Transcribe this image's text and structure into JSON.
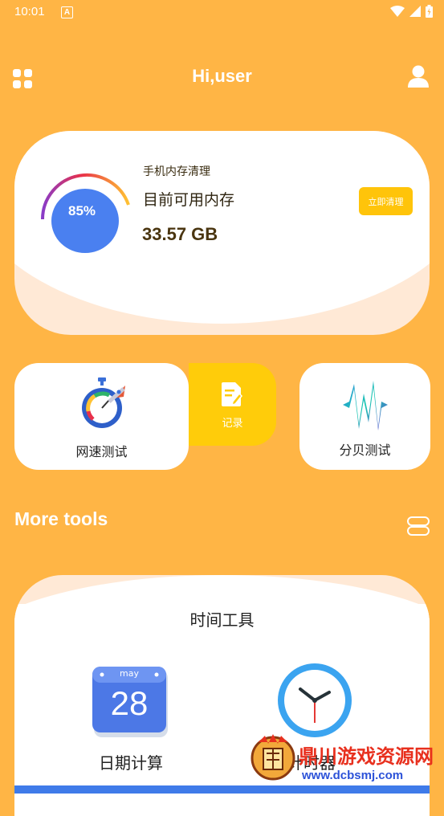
{
  "status_bar": {
    "time": "10:01",
    "notification_glyph": "A"
  },
  "header": {
    "title": "Hi,user",
    "left_icon": "grid-menu-icon",
    "right_icon": "user-icon"
  },
  "memory_card": {
    "percent_text": "85%",
    "percent_value": 85,
    "subtitle": "手机内存清理",
    "title": "目前可用内存",
    "value": "33.57 GB",
    "button_label": "立即清理",
    "colors": {
      "gauge_fill": "#4A80F0",
      "button": "#FFC40A"
    }
  },
  "tools": {
    "speed_test": {
      "label": "网速测试",
      "icon": "stopwatch-rocket-icon"
    },
    "record": {
      "label": "记录",
      "icon": "note-edit-icon"
    },
    "decibel": {
      "label": "分贝测试",
      "icon": "sound-wave-icon"
    }
  },
  "more_tools": {
    "title": "More tools",
    "toggle_icon": "list-toggle-icon",
    "time_card": {
      "title": "时间工具",
      "date_calc": {
        "label": "日期计算",
        "calendar_month": "may",
        "calendar_day": "28"
      },
      "timer": {
        "label": "计时器"
      }
    }
  },
  "watermark": {
    "line1": "鼎川游戏资源网",
    "line2": "www.dcbsmj.com"
  },
  "theme": {
    "background": "#FFB545",
    "accent_blue": "#3F7BE9"
  }
}
